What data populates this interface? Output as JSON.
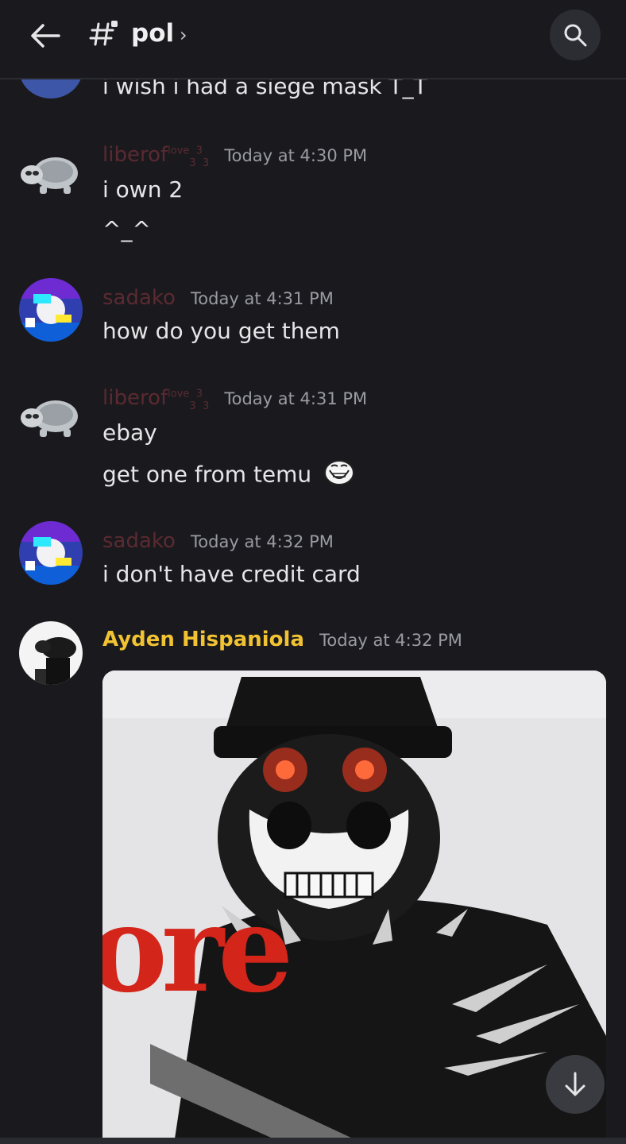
{
  "channel": {
    "name": "pol"
  },
  "messages": [
    {
      "text_lines": [
        "i wish i had a siege mask T_T"
      ]
    },
    {
      "author": "liberof",
      "author_sup": "love",
      "author_sub": "3",
      "author_sup2": "3",
      "author_sub2": "3",
      "time": "Today at 4:30 PM",
      "text_lines": [
        "i own 2",
        "^_^"
      ]
    },
    {
      "author": "sadako",
      "time": "Today at 4:31 PM",
      "text_lines": [
        "how do you get them"
      ]
    },
    {
      "author": "liberof",
      "author_sup": "love",
      "author_sub": "3",
      "author_sup2": "3",
      "author_sub2": "3",
      "time": "Today at 4:31 PM",
      "text_lines": [
        "ebay",
        "get one from temu"
      ]
    },
    {
      "author": "sadako",
      "time": "Today at 4:32 PM",
      "text_lines": [
        "i don't have credit card"
      ]
    },
    {
      "author": "Ayden Hispaniola",
      "time": "Today at 4:32 PM",
      "attachment_text": "ore"
    }
  ],
  "colors": {
    "background": "#1a1a1e",
    "username_dim": "#5a2a30",
    "username_yellow": "#f1c232"
  },
  "icons": [
    "arrow-left-icon",
    "channel-hash-icon",
    "chevron-right-icon",
    "search-icon",
    "arrow-down-icon",
    "trollface-emoji-icon"
  ]
}
